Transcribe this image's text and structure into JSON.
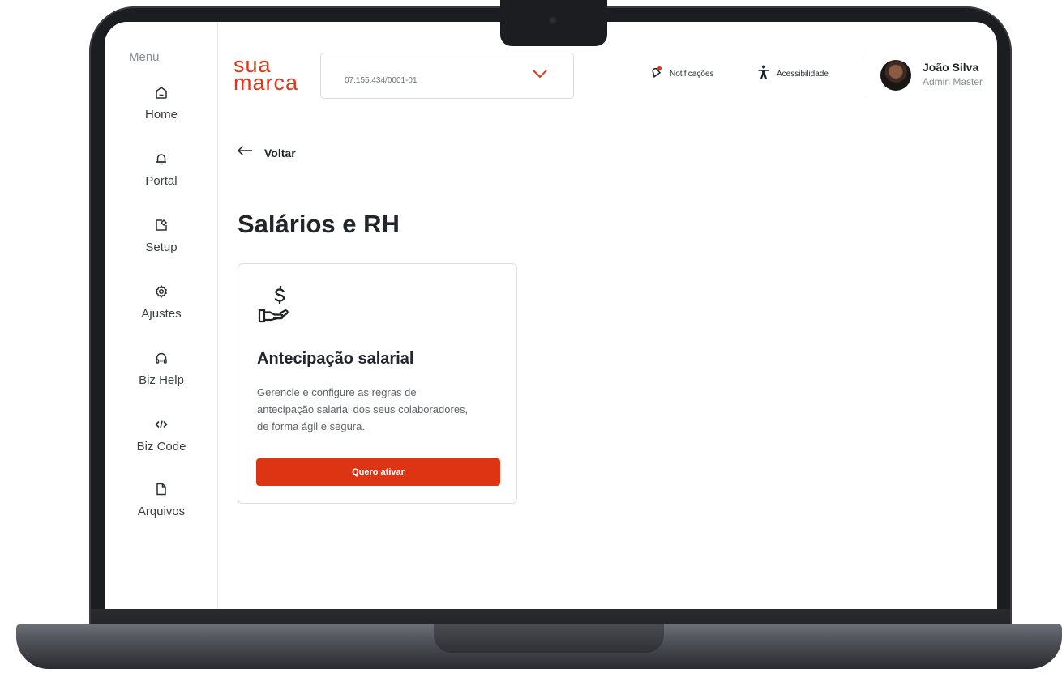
{
  "sidebar": {
    "title": "Menu",
    "items": [
      {
        "label": "Home",
        "icon": "home-icon"
      },
      {
        "label": "Portal",
        "icon": "bell-icon"
      },
      {
        "label": "Setup",
        "icon": "setup-icon"
      },
      {
        "label": "Ajustes",
        "icon": "gear-icon"
      },
      {
        "label": "Biz Help",
        "icon": "headset-icon"
      },
      {
        "label": "Biz Code",
        "icon": "code-icon"
      },
      {
        "label": "Arquivos",
        "icon": "file-icon"
      }
    ]
  },
  "header": {
    "logo_line1": "sua",
    "logo_line2": "marca",
    "company_select_value": "07.155.434/0001-01",
    "notifications_label": "Notificações",
    "accessibility_label": "Acessibilidade",
    "user_name": "João Silva",
    "user_role": "Admin Master"
  },
  "content": {
    "back_label": "Voltar",
    "page_title": "Salários e RH",
    "card": {
      "title": "Antecipação salarial",
      "description": "Gerencie e configure as regras de antecipação salarial dos seus colaboradores, de forma ágil e segura.",
      "button_label": "Quero ativar",
      "icon": "salary-hand-icon"
    }
  },
  "colors": {
    "brand": "#e0361a",
    "button": "#dd3413",
    "frame": "#1c1d20"
  }
}
